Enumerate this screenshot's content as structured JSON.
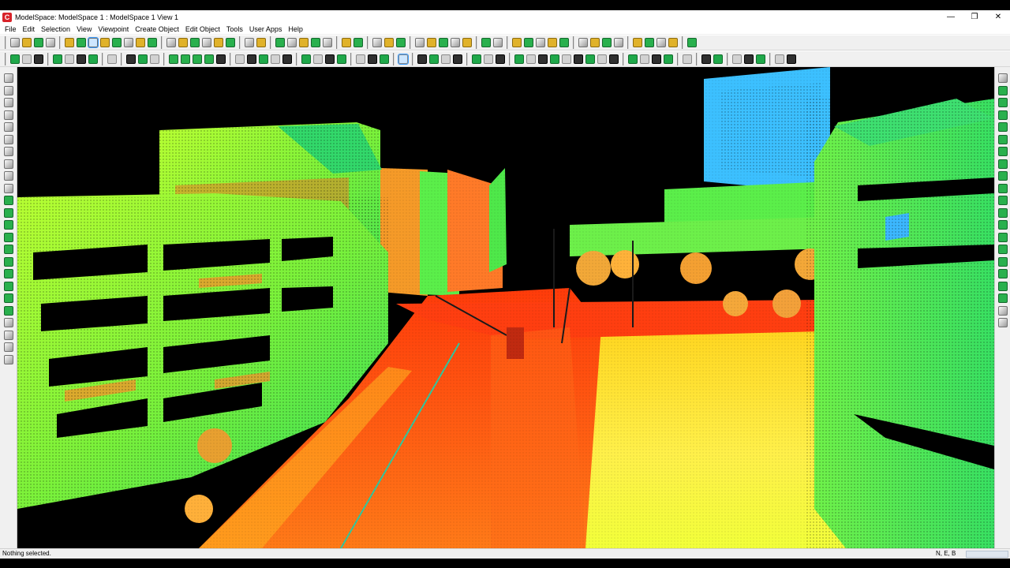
{
  "window": {
    "title": "ModelSpace: ModelSpace 1 : ModelSpace 1 View 1",
    "app_icon": "C",
    "minimize": "—",
    "restore": "❐",
    "close": "✕"
  },
  "menu": [
    "File",
    "Edit",
    "Selection",
    "View",
    "Viewpoint",
    "Create Object",
    "Edit Object",
    "Tools",
    "User Apps",
    "Help"
  ],
  "toolbar1": {
    "groups": [
      {
        "icons": [
          "new-model-icon",
          "open-model-icon",
          "save-icon",
          "print-icon"
        ]
      },
      {
        "icons": [
          "select-arrow-icon",
          "select-plus-icon",
          "pan-hand-icon",
          "pen-draw-icon",
          "lasso-icon",
          "move-cross-icon",
          "rotate-icon",
          "orbit-icon"
        ]
      },
      {
        "icons": [
          "cube-view-icon",
          "fence-polygon-icon",
          "fence-tool-icon",
          "rectangle-fence-icon",
          "circle-fence-icon",
          "cut-plane-icon"
        ]
      },
      {
        "icons": [
          "zoom-in-icon",
          "zoom-out-icon"
        ]
      },
      {
        "icons": [
          "zoom-fit-icon",
          "zoom-window-icon",
          "zoom-extents-icon",
          "zoom-previous-icon",
          "zoom-selection-icon"
        ]
      },
      {
        "icons": [
          "render-layer-icon",
          "render-fill-icon"
        ]
      },
      {
        "icons": [
          "color-icon",
          "intensity-icon",
          "normals-icon"
        ]
      },
      {
        "icons": [
          "measure-icon",
          "copy-icon",
          "help-icon",
          "snap-icon",
          "probe-icon"
        ]
      },
      {
        "icons": [
          "layers-icon",
          "visible-layers-icon"
        ]
      },
      {
        "icons": [
          "tree-icon",
          "scan-icon",
          "sphere-icon",
          "object-icon",
          "group-icon"
        ]
      },
      {
        "icons": [
          "branch-icon",
          "edge-icon",
          "fit-icon",
          "merge-icon"
        ]
      },
      {
        "icons": [
          "camera-icon",
          "camera-save-icon",
          "camera-flag-icon",
          "camera-dual-icon"
        ]
      },
      {
        "icons": [
          "hand-grab-icon"
        ]
      }
    ]
  },
  "toolbar2": {
    "groups": [
      {
        "icons": [
          "display-icon",
          "image-view-icon",
          "photo-icon"
        ]
      },
      {
        "icons": [
          "link-icon",
          "link-break-icon",
          "pan-icon",
          "cursor-icon"
        ]
      },
      {
        "icons": [
          "scene-icon"
        ]
      },
      {
        "icons": [
          "grid-icon",
          "grid-snap-icon",
          "grid-lock-icon"
        ]
      },
      {
        "icons": [
          "green-square-1-icon",
          "green-square-2-icon",
          "green-square-3-icon",
          "green-square-4-icon",
          "black-square-icon"
        ]
      },
      {
        "icons": [
          "stack-icon",
          "object-tools-icon",
          "extract-icon",
          "edit-points-icon",
          "tag-icon"
        ]
      },
      {
        "icons": [
          "record-icon",
          "render-icon",
          "light-icon",
          "color-map-icon"
        ]
      },
      {
        "icons": [
          "flip-x-icon",
          "flip-y-icon",
          "axis-z-icon"
        ]
      },
      {
        "icons": [
          "up-arrow-icon"
        ]
      },
      {
        "icons": [
          "point-style-icon",
          "point-size-icon",
          "point-shade-icon",
          "filter-icon"
        ]
      },
      {
        "icons": [
          "curve-icon",
          "mesh-icon",
          "surface-icon"
        ]
      },
      {
        "icons": [
          "plane-icon",
          "cylinder-icon",
          "box-icon",
          "sphere-fit-icon",
          "cone-icon",
          "torus-icon",
          "elbow-icon",
          "reducer-icon",
          "tee-icon"
        ]
      },
      {
        "icons": [
          "dimension-icon",
          "leader-icon",
          "note-icon",
          "marker-icon"
        ]
      },
      {
        "icons": [
          "limit-box-icon"
        ]
      },
      {
        "icons": [
          "slice-icon",
          "section-icon"
        ]
      },
      {
        "icons": [
          "sequence-1-icon",
          "sequence-2-icon",
          "sequence-3-icon"
        ]
      },
      {
        "icons": [
          "chain-icon",
          "polyline-icon"
        ]
      }
    ]
  },
  "left_tools": [
    "pencil-icon",
    "eraser-icon",
    "magic-wand-icon",
    "polyline-tool-icon",
    "arc-tool-icon",
    "rectangle-tool-icon",
    "face-tool-icon",
    "circle-tool-icon",
    "cylinder-tool-icon",
    "spline-tool-icon",
    "line-green-1-icon",
    "line-green-2-icon",
    "line-green-3-icon",
    "line-green-4-icon",
    "line-green-5-icon",
    "line-green-6-icon",
    "line-green-7-icon",
    "line-green-8-icon",
    "line-green-9-icon",
    "line-green-10-icon",
    "extend-icon",
    "trim-icon",
    "offset-icon",
    "stamp-icon"
  ],
  "right_tools": [
    "pencil-right-icon",
    "vertex-1-icon",
    "vertex-2-icon",
    "vertex-3-icon",
    "vertex-4-icon",
    "vertex-5-icon",
    "vertex-6-icon",
    "vertex-7-icon",
    "vertex-8-icon",
    "vertex-9-icon",
    "vertex-10-icon",
    "vertex-11-icon",
    "vertex-12-icon",
    "vertex-13-icon",
    "vertex-14-icon",
    "vertex-15-icon",
    "vertex-16-icon",
    "vertex-17-icon",
    "vertex-18-icon",
    "cutter-icon",
    "stamp-right-icon"
  ],
  "viewport": {
    "content": "point cloud"
  },
  "status": {
    "text": "Nothing selected.",
    "coords": "N, E, B"
  }
}
